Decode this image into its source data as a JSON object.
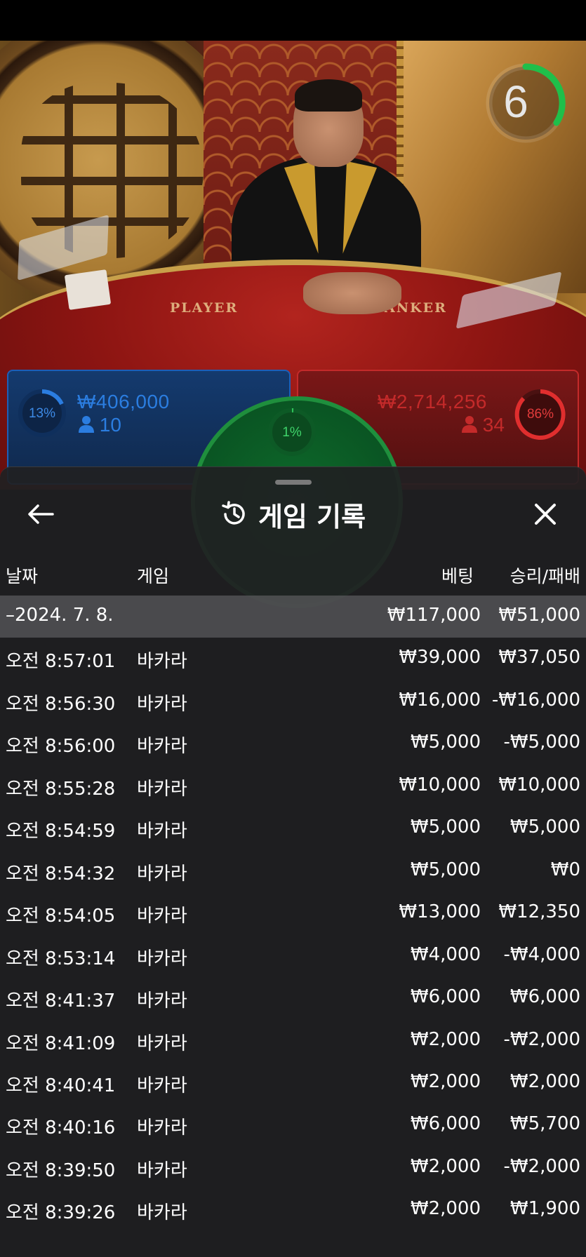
{
  "live": {
    "timer": "6",
    "table_labels": {
      "player": "PLAYER",
      "banker": "BANKER"
    },
    "player": {
      "percent": "13%",
      "percent_value": 0.13,
      "amount": "₩406,000",
      "count": "10"
    },
    "banker": {
      "percent": "86%",
      "percent_value": 0.86,
      "amount": "₩2,714,256",
      "count": "34"
    },
    "tie": {
      "percent": "1%",
      "percent_value": 0.01
    }
  },
  "history": {
    "title": "게임 기록",
    "columns": {
      "date": "날짜",
      "game": "게임",
      "bet": "베팅",
      "result": "승리/패배"
    },
    "summary": {
      "date": "–2024. 7. 8.",
      "bet": "₩117,000",
      "result": "₩51,000"
    },
    "rows": [
      {
        "time": "오전 8:57:01",
        "game": "바카라",
        "bet": "₩39,000",
        "result": "₩37,050"
      },
      {
        "time": "오전 8:56:30",
        "game": "바카라",
        "bet": "₩16,000",
        "result": "-₩16,000"
      },
      {
        "time": "오전 8:56:00",
        "game": "바카라",
        "bet": "₩5,000",
        "result": "-₩5,000"
      },
      {
        "time": "오전 8:55:28",
        "game": "바카라",
        "bet": "₩10,000",
        "result": "₩10,000"
      },
      {
        "time": "오전 8:54:59",
        "game": "바카라",
        "bet": "₩5,000",
        "result": "₩5,000"
      },
      {
        "time": "오전 8:54:32",
        "game": "바카라",
        "bet": "₩5,000",
        "result": "₩0"
      },
      {
        "time": "오전 8:54:05",
        "game": "바카라",
        "bet": "₩13,000",
        "result": "₩12,350"
      },
      {
        "time": "오전 8:53:14",
        "game": "바카라",
        "bet": "₩4,000",
        "result": "-₩4,000"
      },
      {
        "time": "오전 8:41:37",
        "game": "바카라",
        "bet": "₩6,000",
        "result": "₩6,000"
      },
      {
        "time": "오전 8:41:09",
        "game": "바카라",
        "bet": "₩2,000",
        "result": "-₩2,000"
      },
      {
        "time": "오전 8:40:41",
        "game": "바카라",
        "bet": "₩2,000",
        "result": "₩2,000"
      },
      {
        "time": "오전 8:40:16",
        "game": "바카라",
        "bet": "₩6,000",
        "result": "₩5,700"
      },
      {
        "time": "오전 8:39:50",
        "game": "바카라",
        "bet": "₩2,000",
        "result": "-₩2,000"
      },
      {
        "time": "오전 8:39:26",
        "game": "바카라",
        "bet": "₩2,000",
        "result": "₩1,900"
      }
    ]
  },
  "colors": {
    "player": "#1f6fd1",
    "banker": "#d12a2a",
    "tie": "#22a044",
    "timer": "#1fbf4a"
  },
  "icons": {
    "back": "arrow-left-icon",
    "history": "history-clock-icon",
    "close": "close-icon",
    "person": "person-icon"
  }
}
